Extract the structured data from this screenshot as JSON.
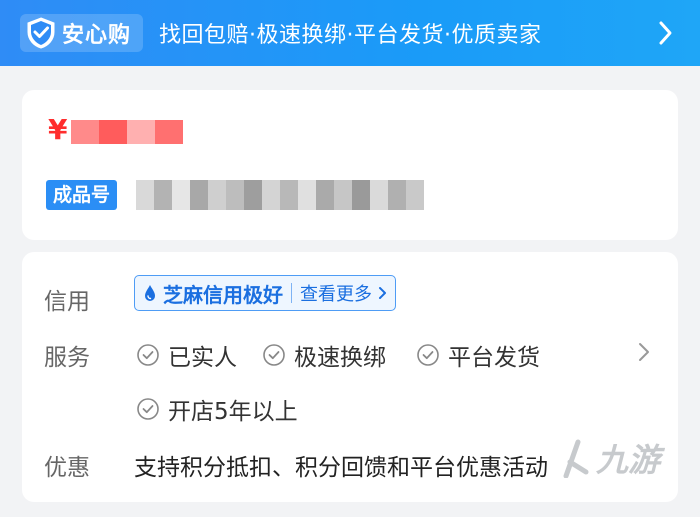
{
  "banner": {
    "badge_label": "安心购",
    "slogan": "找回包赔·极速换绑·平台发货·优质卖家"
  },
  "product": {
    "currency_symbol": "¥",
    "sku_tag": "成品号"
  },
  "details": {
    "credit_label": "信用",
    "credit_badge": "芝麻信用极好",
    "credit_more": "查看更多",
    "service_label": "服务",
    "services": [
      "已实人",
      "极速换绑",
      "平台发货",
      "开店5年以上"
    ],
    "promo_label": "优惠",
    "promo_text": "支持积分抵扣、积分回馈和平台优惠活动"
  },
  "watermark": {
    "text": "九游"
  },
  "colors": {
    "banner_blue": "#2f8cf6",
    "price_red": "#ff2d2d",
    "link_blue": "#1b6fe0"
  }
}
